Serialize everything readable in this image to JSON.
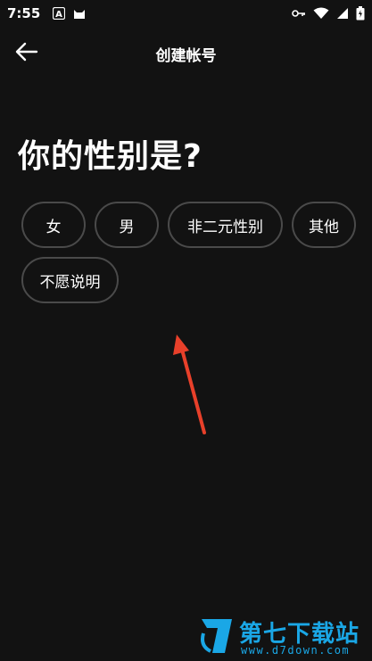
{
  "status_bar": {
    "time": "7:55",
    "left_icons": [
      "font-a-icon",
      "cat-icon"
    ],
    "right_icons": [
      "key-icon",
      "wifi-icon",
      "signal-icon",
      "battery-icon"
    ]
  },
  "header": {
    "title": "创建帐号",
    "back_icon": "arrow-left-icon"
  },
  "question": "你的性别是?",
  "options": [
    "女",
    "男",
    "非二元性别",
    "其他",
    "不愿说明"
  ],
  "watermark": {
    "title": "第七下载站",
    "url": "www.d7down.com"
  },
  "colors": {
    "background": "#121212",
    "pill_border": "#4a4a4a",
    "annotation_arrow": "#e8402a",
    "watermark": "#1aa7e6"
  }
}
